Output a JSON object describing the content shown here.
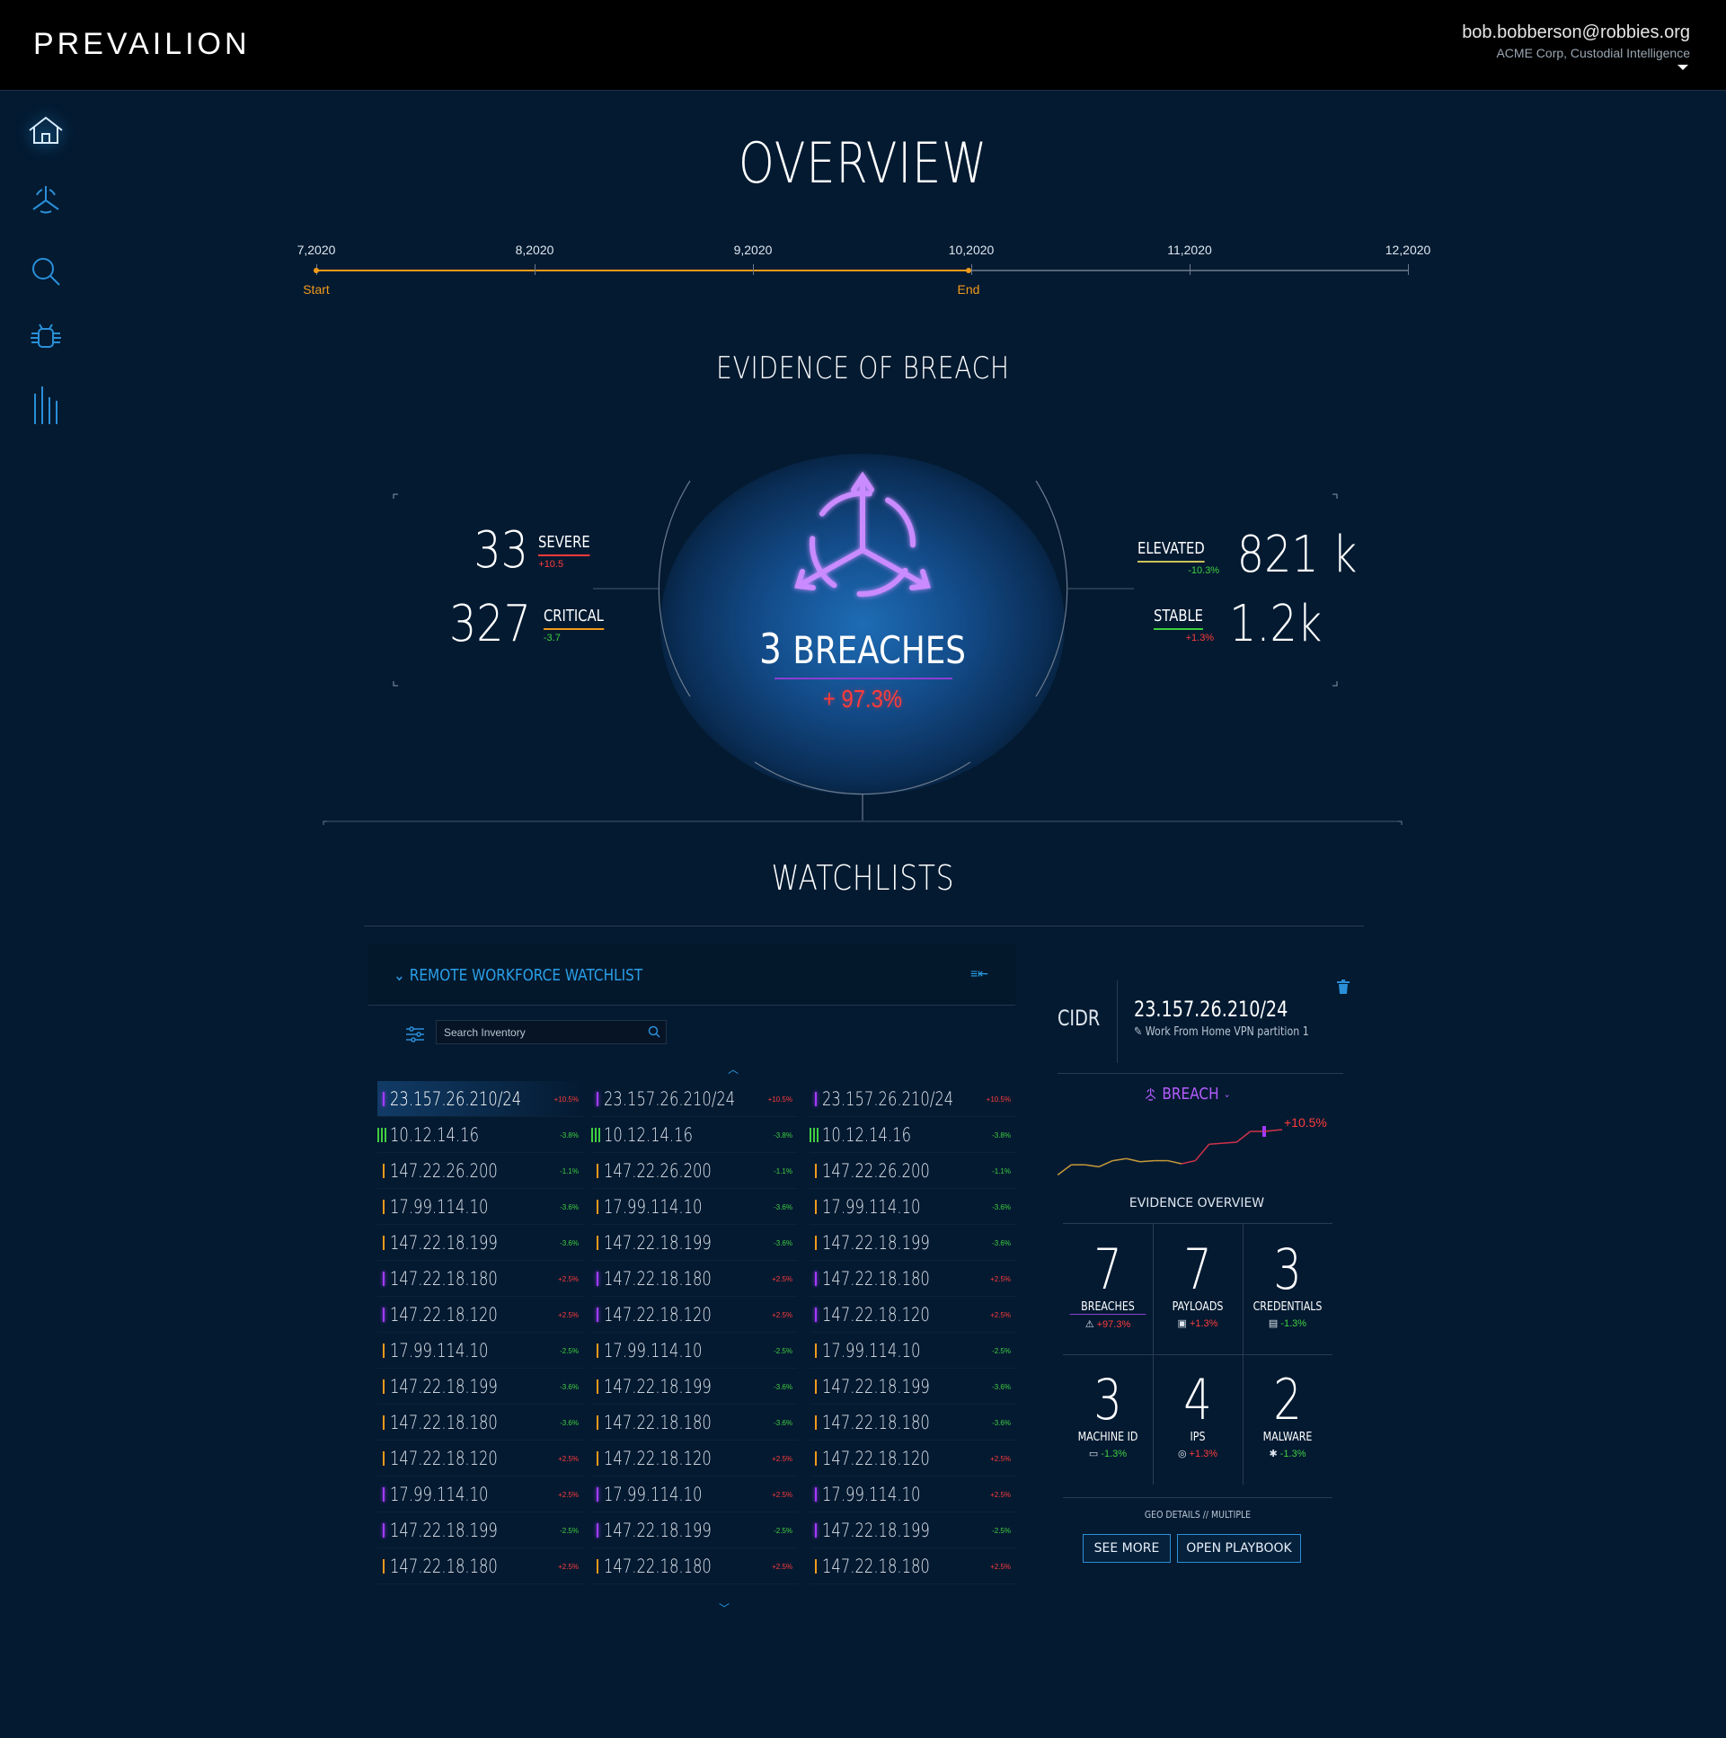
{
  "header": {
    "logo": "PREVAILION",
    "user_email": "bob.bobberson@robbies.org",
    "user_org": "ACME Corp, Custodial Intelligence"
  },
  "sidebar": {
    "items": [
      {
        "icon": "home-icon",
        "active": true
      },
      {
        "icon": "breach-icon",
        "active": false
      },
      {
        "icon": "search-icon",
        "active": false
      },
      {
        "icon": "malware-icon",
        "active": false
      },
      {
        "icon": "analytics-icon",
        "active": false
      }
    ]
  },
  "overview": {
    "title": "OVERVIEW",
    "timeline": {
      "ticks": [
        "7,2020",
        "8,2020",
        "9,2020",
        "10,2020",
        "11,2020",
        "12,2020"
      ],
      "start_label": "Start",
      "end_label": "End"
    }
  },
  "breach": {
    "title": "EVIDENCE OF BREACH",
    "count": "3",
    "count_label": "BREACHES",
    "change": "+ 97.3%",
    "severe": {
      "value": "33",
      "label": "SEVERE",
      "change": "+10.5"
    },
    "critical": {
      "value": "327",
      "label": "CRITICAL",
      "change": "-3.7"
    },
    "elevated": {
      "value": "821 k",
      "label": "ELEVATED",
      "change": "-10.3%"
    },
    "stable": {
      "value": "1.2k",
      "label": "STABLE",
      "change": "+1.3%"
    }
  },
  "watchlists": {
    "title": "WATCHLISTS",
    "list_title": "REMOTE WORKFORCE WATCHLIST",
    "search_placeholder": "Search Inventory",
    "rows": [
      {
        "ip": "23.157.26.210/24",
        "change": "+10.5%",
        "status": "purple"
      },
      {
        "ip": "10.12.14.16",
        "change": "-3.8%",
        "status": "green"
      },
      {
        "ip": "147.22.26.200",
        "change": "-1.1%",
        "status": "orange"
      },
      {
        "ip": "17.99.114.10",
        "change": "-3.6%",
        "status": "orange"
      },
      {
        "ip": "147.22.18.199",
        "change": "-3.6%",
        "status": "orange"
      },
      {
        "ip": "147.22.18.180",
        "change": "+2.5%",
        "status": "purple"
      },
      {
        "ip": "147.22.18.120",
        "change": "+2.5%",
        "status": "purple"
      },
      {
        "ip": "17.99.114.10",
        "change": "-2.5%",
        "status": "orange"
      },
      {
        "ip": "147.22.18.199",
        "change": "-3.6%",
        "status": "orange"
      },
      {
        "ip": "147.22.18.180",
        "change": "-3.6%",
        "status": "orange"
      },
      {
        "ip": "147.22.18.120",
        "change": "+2.5%",
        "status": "orange"
      },
      {
        "ip": "17.99.114.10",
        "change": "+2.5%",
        "status": "purple"
      },
      {
        "ip": "147.22.18.199",
        "change": "-2.5%",
        "status": "purple"
      },
      {
        "ip": "147.22.18.180",
        "change": "+2.5%",
        "status": "orange"
      }
    ]
  },
  "detail": {
    "cidr_label": "CIDR",
    "cidr_value": "23.157.26.210/24",
    "cidr_desc": "Work From Home VPN partition 1",
    "tag": "BREACH",
    "spark_change": "+10.5%",
    "spark_values": [
      2,
      4,
      4,
      3.6,
      4.8,
      5.2,
      4.6,
      4.8,
      4.8,
      4.2,
      4.8,
      8,
      8.2,
      8.4,
      10.5,
      10.5
    ],
    "evidence_title": "EVIDENCE OVERVIEW",
    "evidence": [
      {
        "value": "7",
        "label": "BREACHES",
        "change": "+97.3%",
        "up": true,
        "icon": "breach-icon"
      },
      {
        "value": "7",
        "label": "PAYLOADS",
        "change": "+1.3%",
        "up": true,
        "icon": "payload-icon"
      },
      {
        "value": "3",
        "label": "CREDENTIALS",
        "change": "-1.3%",
        "up": false,
        "icon": "credentials-icon"
      },
      {
        "value": "3",
        "label": "MACHINE ID",
        "change": "-1.3%",
        "up": false,
        "icon": "machine-id-icon"
      },
      {
        "value": "4",
        "label": "IPS",
        "change": "+1.3%",
        "up": true,
        "icon": "ips-icon"
      },
      {
        "value": "2",
        "label": "MALWARE",
        "change": "-1.3%",
        "up": false,
        "icon": "malware-icon"
      }
    ],
    "geo": "GEO DETAILS  //  MULTIPLE",
    "see_more": "SEE MORE",
    "open_playbook": "OPEN PLAYBOOK"
  },
  "colors": {
    "accent": "#2a8fd8",
    "purple": "#a23bff",
    "up": "#ff3b3b",
    "down": "#3fcf3f",
    "orange": "#f29a1a",
    "green": "#3fcf3f"
  }
}
